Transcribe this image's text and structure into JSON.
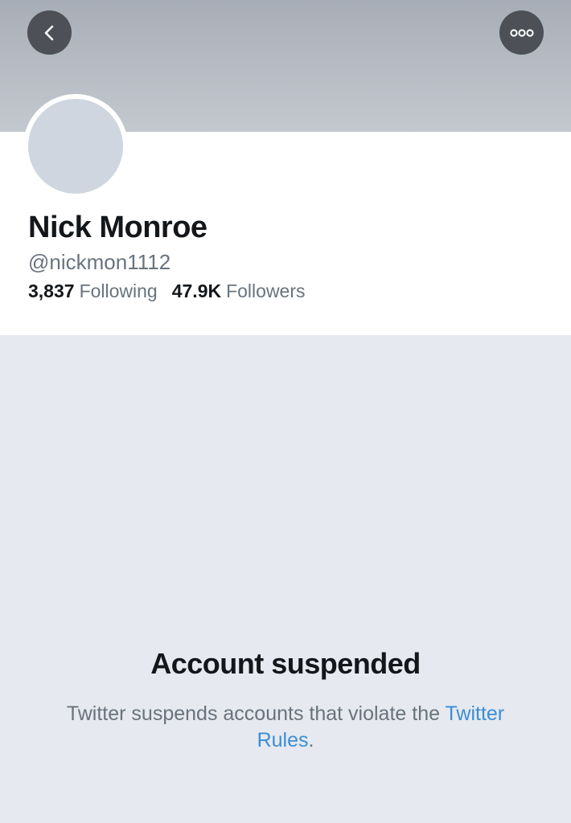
{
  "header": {
    "back_icon": "chevron-left-icon",
    "more_icon": "more-options-icon"
  },
  "profile": {
    "name": "Nick Monroe",
    "handle": "@nickmon1112",
    "following_count": "3,837",
    "following_label": "Following",
    "followers_count": "47.9K",
    "followers_label": "Followers"
  },
  "notice": {
    "title": "Account suspended",
    "message": "Twitter suspends accounts that violate the",
    "link_text": "Twitter Rules",
    "punctuation": "."
  },
  "colors": {
    "link": "#3b8ed6",
    "text_primary": "#14171a",
    "text_secondary": "#69737d",
    "page_background": "#e6e9ef"
  }
}
